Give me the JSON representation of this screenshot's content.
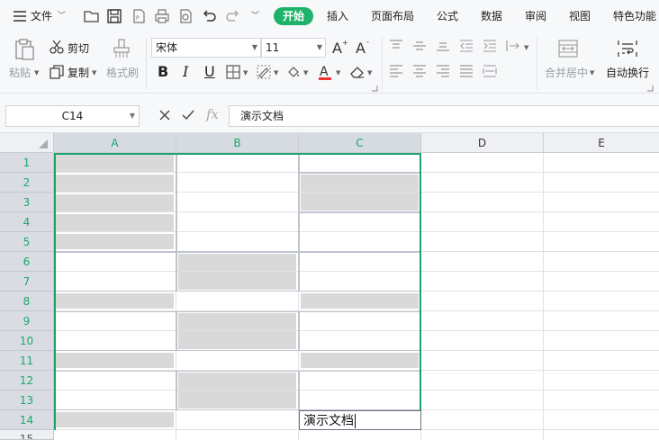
{
  "menubar": {
    "file": "文件",
    "tabs": [
      {
        "label": "开始",
        "active": true
      },
      {
        "label": "插入",
        "active": false
      },
      {
        "label": "页面布局",
        "active": false
      },
      {
        "label": "公式",
        "active": false
      },
      {
        "label": "数据",
        "active": false
      },
      {
        "label": "审阅",
        "active": false
      },
      {
        "label": "视图",
        "active": false
      },
      {
        "label": "特色功能",
        "active": false
      }
    ]
  },
  "ribbon": {
    "paste": "粘贴",
    "cut": "剪切",
    "copy": "复制",
    "format_painter": "格式刷",
    "font_name": "宋体",
    "font_size": "11",
    "merge_center": "合并居中",
    "wrap_text": "自动换行",
    "bold": "B",
    "italic": "I",
    "underline": "U"
  },
  "formula_bar": {
    "name_box": "C14",
    "formula": "演示文档",
    "fx": "fx"
  },
  "sheet": {
    "columns": [
      "A",
      "B",
      "C",
      "D",
      "E"
    ],
    "rows": [
      "1",
      "2",
      "3",
      "4",
      "5",
      "6",
      "7",
      "8",
      "9",
      "10",
      "11",
      "12",
      "13",
      "14",
      "15"
    ],
    "active_cell": "C14",
    "active_cell_text": "演示文档"
  },
  "colors": {
    "accent": "#1fb26b",
    "selection_border": "#1fa36a",
    "cell_fill": "#d9d9d9"
  }
}
